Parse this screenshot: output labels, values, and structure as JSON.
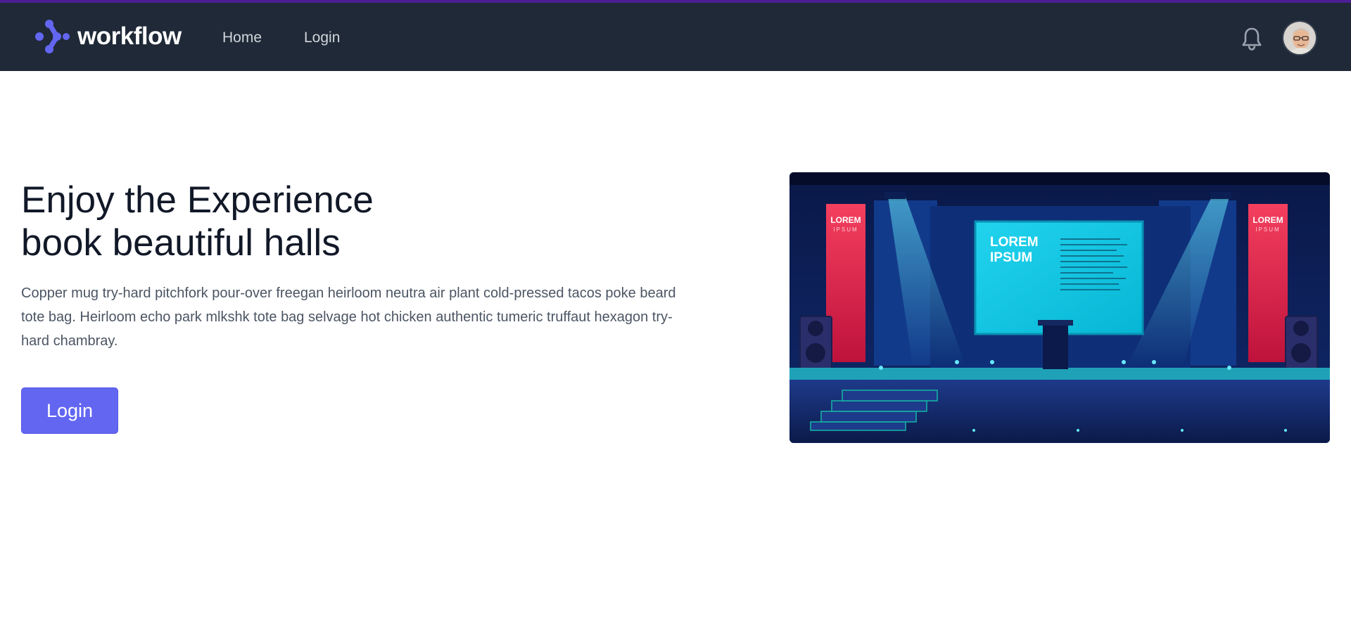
{
  "brand": {
    "name": "workflow",
    "logo_icon": "workflow-logo-icon",
    "accent": "#6366f1"
  },
  "nav": {
    "items": [
      {
        "label": "Home"
      },
      {
        "label": "Login"
      }
    ]
  },
  "header": {
    "notification_icon": "bell-icon",
    "avatar_icon": "user-avatar"
  },
  "hero": {
    "title_line1": "Enjoy the Experience",
    "title_line2": "book beautiful halls",
    "description": "Copper mug try-hard pitchfork pour-over freegan heirloom neutra air plant cold-pressed tacos poke beard tote bag. Heirloom echo park mlkshk tote bag selvage hot chicken authentic tumeric truffaut hexagon try-hard chambray.",
    "button_label": "Login",
    "image": {
      "screen_line1": "LOREM",
      "screen_line2": "IPSUM",
      "banner_line1": "LOREM",
      "banner_line2": "IPSUM"
    }
  },
  "colors": {
    "navbar": "#1f2937",
    "top_line": "#4c1d95",
    "button": "#6366f1"
  }
}
